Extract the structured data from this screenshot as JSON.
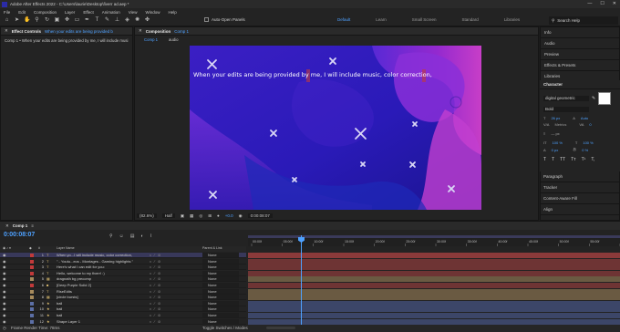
{
  "titlebar": {
    "title": "Adobe After Effects 2022 - C:\\Users\\laurie\\Desktop\\fiverr ad.aep *",
    "controls": [
      "—",
      "☐",
      "✕"
    ]
  },
  "menu": [
    "File",
    "Edit",
    "Composition",
    "Layer",
    "Effect",
    "Animation",
    "View",
    "Window",
    "Help"
  ],
  "toolbar": {
    "snap_label": "Auto-Open Panels",
    "workspaces": [
      "Default",
      "Learn",
      "Small Screen",
      "Standard",
      "Libraries"
    ],
    "search_placeholder": "Search Help"
  },
  "effect_controls": {
    "tab": "Effect Controls",
    "tab_value": "When your edits are being provided b",
    "breadcrumb": "Comp 1 • When your edits are being provided by me, I will include musi"
  },
  "composition": {
    "tab": "Composition",
    "tab_value": "Comp 1",
    "subtabs": [
      "Comp 1",
      "audio"
    ],
    "overlay_text": "When your edits are being provided by me, I will include music, color correction,",
    "footer": {
      "zoom": "(82.6%)",
      "quality": "Half",
      "timecode": "0:00:08:07",
      "color": "+0.0"
    }
  },
  "right_panel": {
    "items_top": [
      "Info",
      "Audio",
      "Preview",
      "Effects & Presets",
      "Libraries"
    ],
    "character": {
      "title": "Character",
      "font": "digital geometric",
      "style": "Bold",
      "size": "26 px",
      "leading": "Auto",
      "tracking": "0",
      "stroke": "— px",
      "vscale": "100 %",
      "hscale": "100 %",
      "baseline": "0 px",
      "tsume": "0 %",
      "style_buttons": [
        "T",
        "T",
        "TT",
        "Tт",
        "T¹",
        "T,"
      ]
    },
    "items_bottom": [
      "Paragraph",
      "Tracker",
      "Content-Aware Fill",
      "Align"
    ]
  },
  "timeline": {
    "tab": "Comp 1",
    "timecode": "0:00:08:07",
    "columns": {
      "layer_name": "Layer Name",
      "parent": "Parent & Link"
    },
    "layers": [
      {
        "num": "1",
        "name": "When yo...I will include music, color correction,",
        "label": "#c23a3a",
        "type": "T",
        "parent": "None"
      },
      {
        "num": "2",
        "name": "\" - Youtu...eos - Montages - Gaming highlights \"",
        "label": "#c23a3a",
        "type": "T",
        "parent": "None"
      },
      {
        "num": "3",
        "name": "Here's what I can edit for you:",
        "label": "#c23a3a",
        "type": "T",
        "parent": "None"
      },
      {
        "num": "4",
        "name": "Hello, welcome to my fiverr! :)",
        "label": "#c23a3a",
        "type": "T",
        "parent": "None"
      },
      {
        "num": "5",
        "name": "dragnath bg precomp",
        "label": "#a68a5c",
        "type": "▦",
        "parent": "None"
      },
      {
        "num": "6",
        "name": "[Deep Purple Solid 2]",
        "label": "#c23a3a",
        "type": "■",
        "parent": "None"
      },
      {
        "num": "7",
        "name": "RiseEdits",
        "label": "#a68a5c",
        "type": "T",
        "parent": "None"
      },
      {
        "num": "8",
        "name": "[circle bursts]",
        "label": "#a68a5c",
        "type": "▦",
        "parent": "None"
      },
      {
        "num": "9",
        "name": "ball",
        "label": "#5c6fa6",
        "type": "★",
        "parent": "None"
      },
      {
        "num": "10",
        "name": "ball",
        "label": "#5c6fa6",
        "type": "★",
        "parent": "None"
      },
      {
        "num": "11",
        "name": "ball",
        "label": "#5c6fa6",
        "type": "★",
        "parent": "None"
      },
      {
        "num": "12",
        "name": "Shape Layer 1",
        "label": "#5c6fa6",
        "type": "★",
        "parent": "None"
      }
    ],
    "ruler": [
      "00:00f",
      "05:00f",
      "10:00f",
      "15:00f",
      "20:00f",
      "25:00f",
      "30:00f",
      "35:00f",
      "40:00f",
      "45:00f",
      "50:00f",
      "55:00f",
      "01:00f"
    ],
    "footer_left": "Frame Render Time: 78ms",
    "footer_mid": "Toggle Switches / Modes"
  },
  "colors": {
    "accent": "#4ea1ff",
    "bg_dark": "#1d1d1d",
    "panel": "#232323"
  }
}
